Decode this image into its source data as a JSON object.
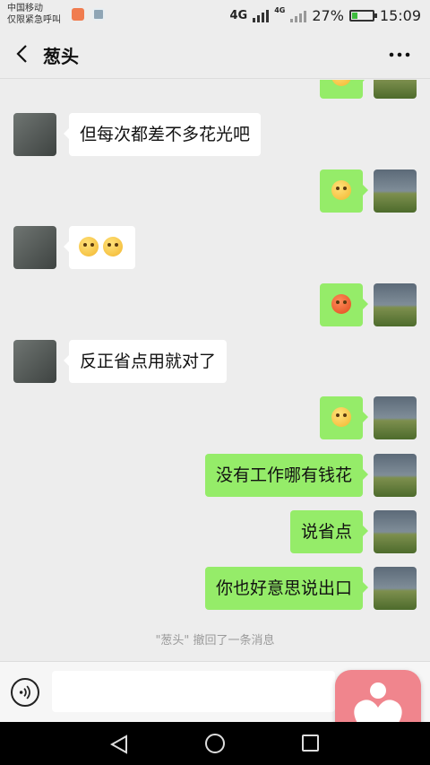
{
  "status_bar": {
    "carrier_line1": "中国移动",
    "carrier_line2": "仅限紧急呼叫",
    "network": "4G",
    "network_small": "4G",
    "battery": "27%",
    "battery_level": 0.27,
    "time": "15:09"
  },
  "header": {
    "title": "葱头",
    "back_icon": "chevron-left-icon",
    "more_icon": "more-horizontal-icon"
  },
  "messages": [
    {
      "side": "out",
      "type": "emoji",
      "emoji": "face-emoji"
    },
    {
      "side": "in",
      "type": "text",
      "text": "但每次都差不多花光吧"
    },
    {
      "side": "out",
      "type": "emoji",
      "emoji": "face-emoji"
    },
    {
      "side": "in",
      "type": "emoji",
      "emoji": "heart-eyes-emoji x2"
    },
    {
      "side": "out",
      "type": "emoji",
      "emoji": "red-face-emoji"
    },
    {
      "side": "in",
      "type": "text",
      "text": "反正省点用就对了"
    },
    {
      "side": "out",
      "type": "emoji",
      "emoji": "smirk-emoji"
    },
    {
      "side": "out",
      "type": "text",
      "text": "没有工作哪有钱花"
    },
    {
      "side": "out",
      "type": "text",
      "text": "说省点"
    },
    {
      "side": "out",
      "type": "text",
      "text": "你也好意思说出口"
    }
  ],
  "system_notice": "\"葱头\" 撤回了一条消息",
  "input": {
    "value": "",
    "placeholder": ""
  },
  "colors": {
    "background": "#ededed",
    "outgoing_bubble": "#95ec69",
    "incoming_bubble": "#ffffff",
    "floating_button": "#f0858d"
  }
}
